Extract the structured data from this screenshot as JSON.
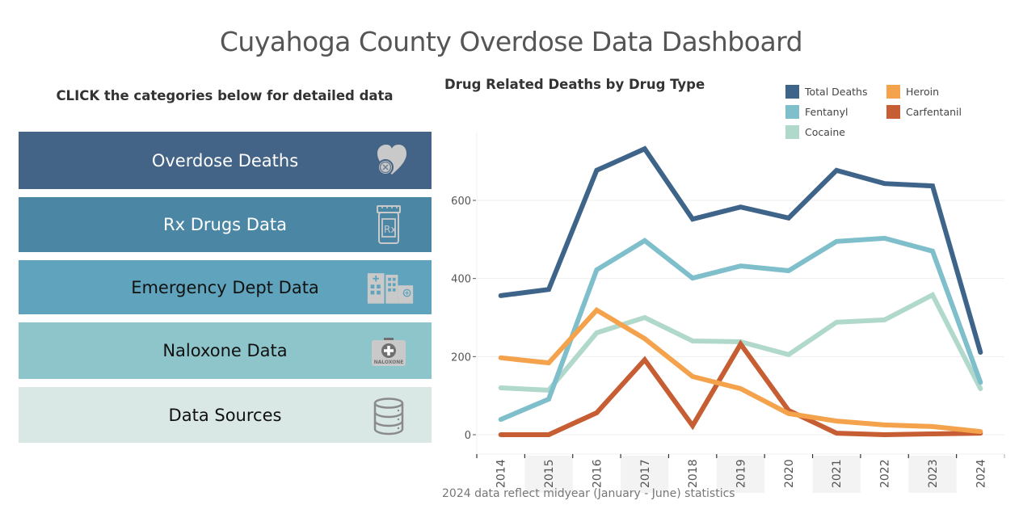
{
  "header": {
    "title": "Cuyahoga County Overdose Data Dashboard"
  },
  "left_panel": {
    "instructions": "CLICK the categories below for detailed data",
    "buttons": [
      {
        "label": "Overdose Deaths",
        "icon": "heart-x-icon",
        "bg": "#436387",
        "fg": "#ffffff"
      },
      {
        "label": "Rx Drugs Data",
        "icon": "prescription-bottle-icon",
        "bg": "#4b87a5",
        "fg": "#ffffff"
      },
      {
        "label": "Emergency Dept Data",
        "icon": "hospital-icon",
        "bg": "#5fa4bc",
        "fg": "#111111"
      },
      {
        "label": "Naloxone Data",
        "icon": "naloxone-kit-icon",
        "bg": "#8ec5cb",
        "fg": "#111111"
      },
      {
        "label": "Data Sources",
        "icon": "database-icon",
        "bg": "#d9e8e5",
        "fg": "#111111"
      }
    ],
    "naloxone_icon_text": "NALOXONE",
    "rx_icon_text": "Rx"
  },
  "chart_data": {
    "type": "line",
    "title": "Drug Related Deaths by Drug Type",
    "xlabel": "",
    "ylabel": "",
    "x": [
      "2014",
      "2015",
      "2016",
      "2017",
      "2018",
      "2019",
      "2020",
      "2021",
      "2022",
      "2023",
      "2024"
    ],
    "yticks": [
      0,
      200,
      400,
      600
    ],
    "ylim": [
      -50,
      770
    ],
    "grid": true,
    "legend_position": "top-right",
    "series": [
      {
        "name": "Total Deaths",
        "color": "#3f6489",
        "values": [
          356,
          372,
          677,
          732,
          552,
          583,
          555,
          677,
          643,
          637,
          211
        ]
      },
      {
        "name": "Fentanyl",
        "color": "#7fbfcb",
        "values": [
          39,
          91,
          422,
          497,
          401,
          432,
          420,
          495,
          503,
          470,
          134
        ]
      },
      {
        "name": "Cocaine",
        "color": "#b0d9cb",
        "values": [
          120,
          114,
          261,
          300,
          240,
          238,
          205,
          288,
          294,
          358,
          118
        ]
      },
      {
        "name": "Heroin",
        "color": "#f4a24b",
        "values": [
          197,
          184,
          319,
          246,
          149,
          118,
          54,
          35,
          25,
          21,
          8
        ]
      },
      {
        "name": "Carfentanil",
        "color": "#c75d32",
        "values": [
          0,
          0,
          56,
          192,
          23,
          232,
          62,
          4,
          0,
          2,
          4
        ]
      }
    ],
    "draw_order": [
      "Cocaine",
      "Fentanyl",
      "Carfentanil",
      "Heroin",
      "Total Deaths"
    ],
    "banded_years": [
      "2015",
      "2017",
      "2019",
      "2021",
      "2023"
    ],
    "footnote": "2024 data reflect midyear (January - June) statistics"
  },
  "legend": {
    "items": [
      {
        "name": "Total Deaths",
        "color": "#3f6489"
      },
      {
        "name": "Fentanyl",
        "color": "#7fbfcb"
      },
      {
        "name": "Cocaine",
        "color": "#b0d9cb"
      },
      {
        "name": "Heroin",
        "color": "#f4a24b"
      },
      {
        "name": "Carfentanil",
        "color": "#c75d32"
      }
    ]
  }
}
